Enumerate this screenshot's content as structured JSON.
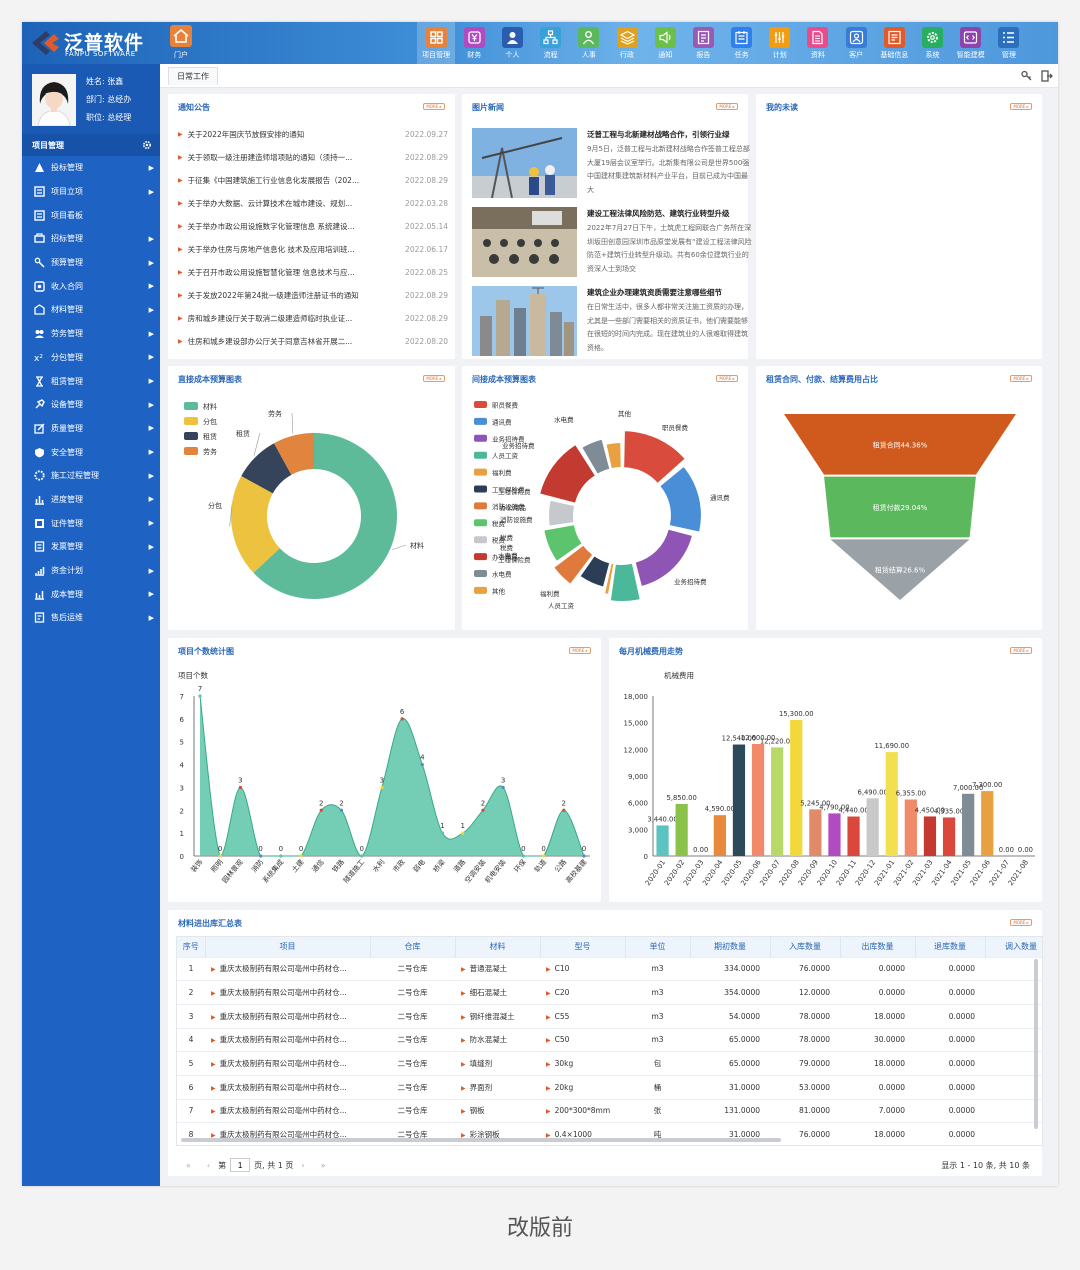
{
  "header": {
    "logo_cn": "泛普软件",
    "logo_en": "FANPU SOFTWARE",
    "portal_label": "门户",
    "nav": [
      {
        "label": "项目管理",
        "icon": "grid-icon",
        "color": "#e8823a"
      },
      {
        "label": "财务",
        "icon": "yen-icon",
        "color": "#b04cc0"
      },
      {
        "label": "个人",
        "icon": "person-icon",
        "color": "#2a5db0"
      },
      {
        "label": "流程",
        "icon": "flow-icon",
        "color": "#3aa0d8"
      },
      {
        "label": "人事",
        "icon": "people-icon",
        "color": "#5cb85c"
      },
      {
        "label": "行政",
        "icon": "layers-icon",
        "color": "#e0a020"
      },
      {
        "label": "通知",
        "icon": "speaker-icon",
        "color": "#6cc04a"
      },
      {
        "label": "报告",
        "icon": "report-icon",
        "color": "#9b59b6"
      },
      {
        "label": "任务",
        "icon": "task-icon",
        "color": "#2f80ed"
      },
      {
        "label": "计划",
        "icon": "plan-icon",
        "color": "#f39c12"
      },
      {
        "label": "资料",
        "icon": "document-icon",
        "color": "#e74c8c"
      },
      {
        "label": "客户",
        "icon": "customer-icon",
        "color": "#3a7bd5"
      },
      {
        "label": "基础信息",
        "icon": "info-icon",
        "color": "#e05a2a"
      },
      {
        "label": "系统",
        "icon": "gear-icon",
        "color": "#27ae60"
      },
      {
        "label": "智能建模",
        "icon": "code-icon",
        "color": "#8e44ad"
      },
      {
        "label": "管理",
        "icon": "list-icon",
        "color": "#2c6fbd"
      }
    ]
  },
  "profile": {
    "name": "姓名: 张鑫",
    "dept": "部门: 总经办",
    "position": "职位: 总经理"
  },
  "sidebar": {
    "title": "项目管理",
    "items": [
      {
        "label": "投标管理",
        "arrow": true
      },
      {
        "label": "项目立项",
        "arrow": true
      },
      {
        "label": "项目看板",
        "arrow": false
      },
      {
        "label": "招标管理",
        "arrow": true
      },
      {
        "label": "预算管理",
        "arrow": true
      },
      {
        "label": "收入合同",
        "arrow": true
      },
      {
        "label": "材料管理",
        "arrow": true
      },
      {
        "label": "劳务管理",
        "arrow": true
      },
      {
        "label": "分包管理",
        "arrow": true
      },
      {
        "label": "租赁管理",
        "arrow": true
      },
      {
        "label": "设备管理",
        "arrow": true
      },
      {
        "label": "质量管理",
        "arrow": true
      },
      {
        "label": "安全管理",
        "arrow": true
      },
      {
        "label": "施工过程管理",
        "arrow": true
      },
      {
        "label": "进度管理",
        "arrow": true
      },
      {
        "label": "证件管理",
        "arrow": true
      },
      {
        "label": "发票管理",
        "arrow": true
      },
      {
        "label": "资金计划",
        "arrow": true
      },
      {
        "label": "成本管理",
        "arrow": true
      },
      {
        "label": "售后运维",
        "arrow": true
      }
    ]
  },
  "tabs": {
    "daily": "日常工作"
  },
  "more_label": "MORE ▸",
  "notice": {
    "title": "通知公告",
    "items": [
      {
        "text": "关于2022年国庆节放假安排的通知",
        "date": "2022.09.27"
      },
      {
        "text": "关于领取一级注册建造师增项贴的通知（须持一...",
        "date": "2022.08.29"
      },
      {
        "text": "于征集《中国建筑施工行业信息化发展报告（202...",
        "date": "2022.08.29"
      },
      {
        "text": "关于举办大数据、云计算技术在城市建设、规划...",
        "date": "2022.03.28"
      },
      {
        "text": "关于举办市政公用设施数字化管理信息 系统建设...",
        "date": "2022.05.14"
      },
      {
        "text": "关于举办住房与房地产信息化 技术及应用培训班...",
        "date": "2022.06.17"
      },
      {
        "text": "关于召开市政公用设施智慧化管理 信息技术与应...",
        "date": "2022.08.25"
      },
      {
        "text": "关于发放2022年第24批一级建造师注册证书的通知",
        "date": "2022.08.29"
      },
      {
        "text": "房和城乡建设厅关于取消二级建造师临时执业证...",
        "date": "2022.08.29"
      },
      {
        "text": "住房和城乡建设部办公厅关于同意吉林省开展二...",
        "date": "2022.08.20"
      }
    ]
  },
  "photo_news": {
    "title": "图片新闻",
    "items": [
      {
        "title": "泛普工程与北新建材战略合作，引领行业绿",
        "body": "9月5日，泛普工程与北新建材战略合作签普工程总部大厦19层会议室举行。北新集有限公司是世界500强中国建材集建筑新材料产业平台，目前已成为中国最大"
      },
      {
        "title": "建设工程法律风险防范、建筑行业转型升级",
        "body": "2022年7月27日下午，土筑虎工程网联合广务所在深圳坂田创意园深圳市品原堂发展有“建设工程法律风险防范+建筑行业转型升级动。共有60余位建筑行业的资深人士到场交"
      },
      {
        "title": "建筑企业办理建筑资质需要注意哪些细节",
        "body": "在日常生活中，很多人都非常关注施工资质的办理，尤其是一些部门需要相关的资质证书，他们需要能够在很短的时间内完成。现在建筑业的人很难取得建筑资格。"
      }
    ]
  },
  "todo": {
    "title": "我的未读"
  },
  "charts": {
    "direct_cost": {
      "title": "直接成本预算图表",
      "chart_data": {
        "type": "pie",
        "variant": "donut",
        "legend": "top-left",
        "slices": [
          {
            "name": "材料",
            "value": 63,
            "color": "#5dbb9a"
          },
          {
            "name": "分包",
            "value": 20,
            "color": "#ecc23f"
          },
          {
            "name": "租赁",
            "value": 9,
            "color": "#35445a"
          },
          {
            "name": "劳务",
            "value": 8,
            "color": "#e0843e"
          }
        ]
      }
    },
    "indirect_cost": {
      "title": "间接成本预算图表",
      "chart_data": {
        "type": "pie",
        "variant": "donut",
        "legend": "left",
        "slices": [
          {
            "name": "职员餐费",
            "value": 11,
            "color": "#d94c3d"
          },
          {
            "name": "通讯费",
            "value": 12,
            "color": "#4a8ed8"
          },
          {
            "name": "业务招待费",
            "value": 14,
            "color": "#8e55b4"
          },
          {
            "name": "人员工资",
            "value": 5,
            "color": "#4cb89a"
          },
          {
            "name": "福利费",
            "value": 1,
            "color": "#e8a040"
          },
          {
            "name": "工程保险费",
            "value": 5,
            "color": "#2c3e55"
          },
          {
            "name": "消防设施费",
            "value": 4,
            "color": "#e07a3c"
          },
          {
            "name": "税费",
            "value": 6,
            "color": "#5cc46c"
          },
          {
            "name": "税费",
            "value": 5,
            "color": "#c5c9ce"
          },
          {
            "name": "办公用品",
            "value": 10,
            "color": "#c23a30"
          },
          {
            "name": "水电费",
            "value": 4,
            "color": "#7f8c95"
          },
          {
            "name": "其他",
            "value": 3,
            "color": "#e8a040"
          }
        ],
        "legend_items": [
          "职员餐费",
          "通讯费",
          "业务招待费",
          "人员工资",
          "福利费",
          "工程保险费",
          "消防设施费",
          "税费",
          "税费",
          "办公用品",
          "水电费",
          "其他"
        ],
        "outer_labels": [
          "其他",
          "职员餐费",
          "水电费",
          "通讯费",
          "业务招待费",
          "人员工资",
          "福利费",
          "工程保险费",
          "水电费",
          "办公用品",
          "消防设施费",
          "税费",
          "税费",
          "工程保险费",
          "业务招待费"
        ]
      }
    },
    "lease": {
      "title": "租赁合同、付款、结算费用占比",
      "chart_data": {
        "type": "funnel",
        "stages": [
          {
            "name": "租赁合同",
            "label": "租赁合同44.36%",
            "value": 44.36,
            "color": "#d05a1e"
          },
          {
            "name": "租赁付款",
            "label": "租赁付款29.04%",
            "value": 29.04,
            "color": "#5cb85c"
          },
          {
            "name": "租赁结算",
            "label": "租赁结算26.6%",
            "value": 26.6,
            "color": "#9aa1a7"
          }
        ]
      }
    },
    "projects": {
      "title": "项目个数统计图",
      "chart_data": {
        "type": "area",
        "ylabel": "项目个数",
        "ylim": [
          0,
          7
        ],
        "yticks": [
          0,
          1,
          2,
          3,
          4,
          5,
          6,
          7
        ],
        "color": "#5cc4a8",
        "categories": [
          "装饰",
          "照明",
          "园林景观",
          "消防",
          "系统集成",
          "土建",
          "通信",
          "铁路",
          "隧道施工",
          "水利",
          "市政",
          "弱电",
          "桥梁",
          "道路",
          "空调安装",
          "机电安装",
          "环保",
          "轨道",
          "公路",
          "高校基建"
        ],
        "values": [
          7,
          0,
          3,
          0,
          0,
          0,
          2,
          2,
          0,
          3,
          6,
          4,
          1,
          1,
          2,
          3,
          0,
          0,
          2,
          0
        ]
      }
    },
    "machinery": {
      "title": "每月机械费用走势",
      "chart_data": {
        "type": "bar",
        "ylabel": "机械费用",
        "ylim": [
          0,
          18000
        ],
        "yticks": [
          "0",
          "3,000",
          "6,000",
          "9,000",
          "12,000",
          "15,000",
          "18,000"
        ],
        "categories": [
          "2020-01",
          "2020-02",
          "2020-03",
          "2020-04",
          "2020-05",
          "2020-06",
          "2020-07",
          "2020-08",
          "2020-09",
          "2020-10",
          "2020-11",
          "2020-12",
          "2021-01",
          "2021-02",
          "2021-03",
          "2021-04",
          "2021-05",
          "2021-06",
          "2021-07",
          "2021-08"
        ],
        "values": [
          3440,
          5850,
          0,
          4590,
          12540,
          12600,
          12220,
          15300,
          5245,
          4790,
          4440,
          6490,
          11690,
          6355,
          4450,
          4335,
          7000,
          7300,
          0,
          0
        ],
        "labels": [
          "3,440.00",
          "5,850.00",
          "0.00",
          "4,590.00",
          "12,540.00",
          "12,600.00",
          "12,220.00",
          "15,300.00",
          "5,245.00",
          "4,790.00",
          "4,440.00",
          "6,490.00",
          "11,690.00",
          "6,355.00",
          "4,450.00",
          "4,335.00",
          "7,000.00",
          "7,300.00",
          "0.00",
          "0.00"
        ],
        "colors": [
          "#5cc4c0",
          "#8bc34a",
          "#8bc34a",
          "#e88a3c",
          "#2c4a5a",
          "#f08a6a",
          "#b8d86a",
          "#f2d83a",
          "#e08a6a",
          "#b04cc0",
          "#d9483b",
          "#c9c9c9",
          "#f2e050",
          "#f08a6a",
          "#c23a30",
          "#d9483b",
          "#7f8c95",
          "#e8a040",
          "#f2d83a",
          "#e88a3c"
        ]
      }
    }
  },
  "materials": {
    "title": "材料进出库汇总表",
    "columns": [
      "序号",
      "项目",
      "仓库",
      "材料",
      "型号",
      "单位",
      "期初数量",
      "入库数量",
      "出库数量",
      "退库数量",
      "调入数量"
    ],
    "rows": [
      [
        "1",
        "重庆太极制药有限公司亳州中药材仓...",
        "二号仓库",
        "普通混凝土",
        "C10",
        "m3",
        "334.0000",
        "76.0000",
        "0.0000",
        "0.0000",
        ""
      ],
      [
        "2",
        "重庆太极制药有限公司亳州中药材仓...",
        "二号仓库",
        "细石混凝土",
        "C20",
        "m3",
        "354.0000",
        "12.0000",
        "0.0000",
        "0.0000",
        ""
      ],
      [
        "3",
        "重庆太极制药有限公司亳州中药材仓...",
        "二号仓库",
        "钢纤维混凝土",
        "C55",
        "m3",
        "54.0000",
        "78.0000",
        "18.0000",
        "0.0000",
        ""
      ],
      [
        "4",
        "重庆太极制药有限公司亳州中药材仓...",
        "二号仓库",
        "防水混凝土",
        "C50",
        "m3",
        "65.0000",
        "78.0000",
        "30.0000",
        "0.0000",
        ""
      ],
      [
        "5",
        "重庆太极制药有限公司亳州中药材仓...",
        "二号仓库",
        "填缝剂",
        "30kg",
        "包",
        "65.0000",
        "79.0000",
        "18.0000",
        "0.0000",
        ""
      ],
      [
        "6",
        "重庆太极制药有限公司亳州中药材仓...",
        "二号仓库",
        "界面剂",
        "20kg",
        "桶",
        "31.0000",
        "53.0000",
        "0.0000",
        "0.0000",
        ""
      ],
      [
        "7",
        "重庆太极制药有限公司亳州中药材仓...",
        "二号仓库",
        "钢板",
        "200*300*8mm",
        "张",
        "131.0000",
        "81.0000",
        "7.0000",
        "0.0000",
        ""
      ],
      [
        "8",
        "重庆太极制药有限公司亳州中药材仓...",
        "二号仓库",
        "彩涂钢板",
        "0.4×1000",
        "吨",
        "31.0000",
        "76.0000",
        "18.0000",
        "0.0000",
        ""
      ]
    ],
    "pager": {
      "page_prefix": "第",
      "page": "1",
      "page_suffix": "页, 共 1 页",
      "info": "显示 1 - 10 条, 共 10 条"
    }
  },
  "caption": "改版前"
}
